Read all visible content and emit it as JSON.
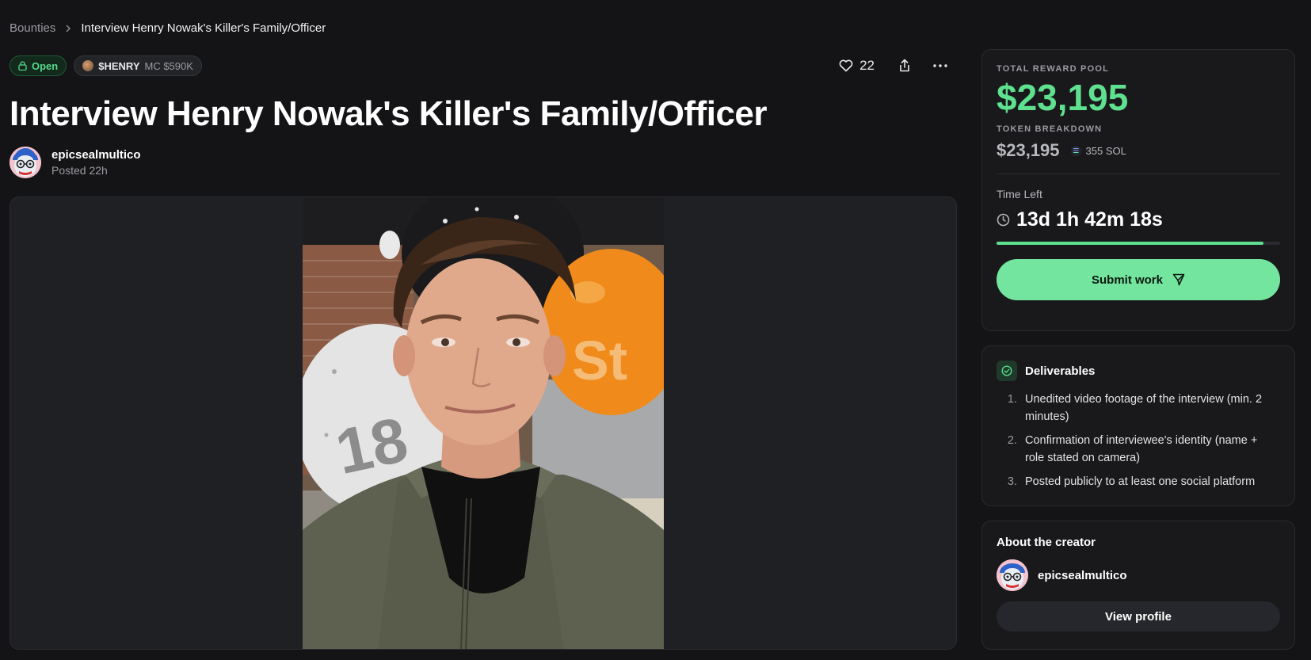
{
  "breadcrumb": {
    "root": "Bounties",
    "current": "Interview Henry Nowak's Killer's Family/Officer"
  },
  "status_badge": "Open",
  "token_badge": {
    "symbol": "$HENRY",
    "market_cap": "MC $590K"
  },
  "likes": "22",
  "title": "Interview Henry Nowak's Killer's Family/Officer",
  "author": {
    "name": "epicsealmultico",
    "posted": "Posted 22h"
  },
  "reward": {
    "label": "TOTAL REWARD POOL",
    "amount": "$23,195",
    "breakdown_label": "TOKEN BREAKDOWN",
    "breakdown_amount": "$23,195",
    "sol": "355 SOL"
  },
  "time_left": {
    "label": "Time Left",
    "value": "13d 1h 42m 18s",
    "progress": 0.94
  },
  "submit_label": "Submit work",
  "deliverables": {
    "title": "Deliverables",
    "items": [
      {
        "num": "1.",
        "text": "Unedited video footage of the interview (min. 2 minutes)"
      },
      {
        "num": "2.",
        "text": "Confirmation of interviewee's identity (name + role stated on camera)"
      },
      {
        "num": "3.",
        "text": "Posted publicly to at least one social platform"
      }
    ]
  },
  "creator": {
    "title": "About the creator",
    "name": "epicsealmultico",
    "view_label": "View profile"
  },
  "colors": {
    "accent": "#5ee08f",
    "button": "#74e59f",
    "background": "#141416"
  }
}
